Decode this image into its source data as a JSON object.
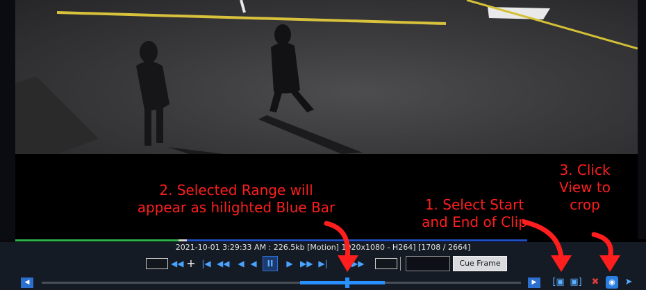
{
  "annotations": {
    "range_line1": "2. Selected Range will",
    "range_line2": "appear as hilighted Blue Bar",
    "select_line1": "1. Select Start",
    "select_line2": "and End of Clip",
    "view_line1": "3. Click",
    "view_line2": "View to",
    "view_line3": "crop"
  },
  "status": {
    "text": "2021-10-01 3:29:33 AM : 226.5kb [Motion] 1920x1080 - H264] [1708 / 2664]"
  },
  "controls": {
    "cue_frame_label": "Cue Frame",
    "cue_input_value": ""
  },
  "colors": {
    "annotation": "#ff1e1e",
    "accent_blue": "#2a8fff",
    "progress_green": "#2fb34a",
    "progress_blue": "#1f4fc4",
    "clear_red": "#e23b3b"
  },
  "icons": {
    "rewind_fast": "rewind-icon",
    "zoom_in": "plus-icon",
    "skip_start": "skip-start-icon",
    "step_back": "step-back-icon",
    "pause": "pause-icon",
    "play": "play-icon",
    "fast_forward": "fast-forward-icon",
    "skip_end": "skip-end-icon",
    "clip_start": "clip-start-icon",
    "clip_end": "clip-end-icon",
    "clear": "clear-icon",
    "view": "eye-icon",
    "export": "export-icon"
  }
}
